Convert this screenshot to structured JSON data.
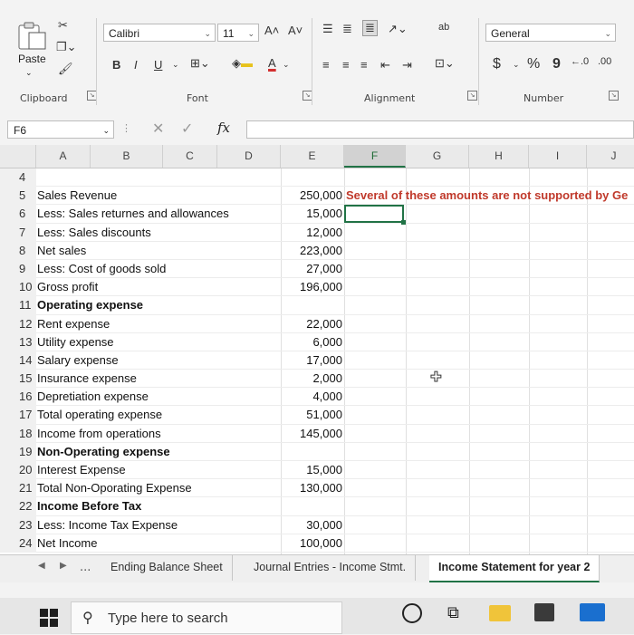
{
  "ribbon": {
    "clipboard": {
      "label": "Clipboard",
      "paste_label": "Paste"
    },
    "font": {
      "label": "Font",
      "name": "Calibri",
      "size": "11",
      "bold": "B",
      "italic": "I",
      "underline": "U",
      "grow": "A˄",
      "shrink": "A˅"
    },
    "alignment": {
      "label": "Alignment",
      "wrap_icon": "ab"
    },
    "number": {
      "label": "Number",
      "format": "General",
      "currency": "$",
      "percent": "%",
      "comma": "9"
    }
  },
  "formula_bar": {
    "cell_ref": "F6",
    "fx": "fx",
    "value": ""
  },
  "columns": [
    "A",
    "B",
    "C",
    "D",
    "E",
    "F",
    "G",
    "H",
    "I",
    "J"
  ],
  "selected_column": "F",
  "rows": [
    {
      "num": "4",
      "label": "",
      "value": "",
      "bold": false
    },
    {
      "num": "5",
      "label": "Sales Revenue",
      "value": "250,000",
      "bold": false
    },
    {
      "num": "6",
      "label": "Less: Sales returnes and allowances",
      "value": "15,000",
      "bold": false
    },
    {
      "num": "7",
      "label": "Less: Sales discounts",
      "value": "12,000",
      "bold": false
    },
    {
      "num": "8",
      "label": "Net sales",
      "value": "223,000",
      "bold": false
    },
    {
      "num": "9",
      "label": "Less: Cost of goods sold",
      "value": "27,000",
      "bold": false
    },
    {
      "num": "10",
      "label": "Gross profit",
      "value": "196,000",
      "bold": false
    },
    {
      "num": "11",
      "label": "Operating expense",
      "value": "",
      "bold": true
    },
    {
      "num": "12",
      "label": "Rent expense",
      "value": "22,000",
      "bold": false
    },
    {
      "num": "13",
      "label": "Utility expense",
      "value": "6,000",
      "bold": false
    },
    {
      "num": "14",
      "label": "Salary expense",
      "value": "17,000",
      "bold": false
    },
    {
      "num": "15",
      "label": "Insurance expense",
      "value": "2,000",
      "bold": false
    },
    {
      "num": "16",
      "label": "Depretiation expense",
      "value": "4,000",
      "bold": false
    },
    {
      "num": "17",
      "label": "Total operating expense",
      "value": "51,000",
      "bold": false
    },
    {
      "num": "18",
      "label": "Income from operations",
      "value": "145,000",
      "bold": false
    },
    {
      "num": "19",
      "label": "Non-Operating expense",
      "value": "",
      "bold": true
    },
    {
      "num": "20",
      "label": "Interest Expense",
      "value": "15,000",
      "bold": false
    },
    {
      "num": "21",
      "label": "Total Non-Oporating Expense",
      "value": "130,000",
      "bold": false
    },
    {
      "num": "22",
      "label": "Income Before Tax",
      "value": "",
      "bold": true
    },
    {
      "num": "23",
      "label": "Less: Income Tax Expense",
      "value": "30,000",
      "bold": false
    },
    {
      "num": "24",
      "label": "Net Income",
      "value": "100,000",
      "bold": false
    }
  ],
  "note": "Several of these amounts are not supported by Ge",
  "sheet_tabs": {
    "ellipsis": "...",
    "items": [
      "Ending Balance Sheet",
      "Journal Entries - Income Stmt.",
      "Income Statement for year 2"
    ],
    "active": "Income Statement for year 2"
  },
  "taskbar": {
    "search_placeholder": "Type here to search"
  },
  "colors": {
    "accent": "#217346",
    "note": "#c0392b"
  }
}
